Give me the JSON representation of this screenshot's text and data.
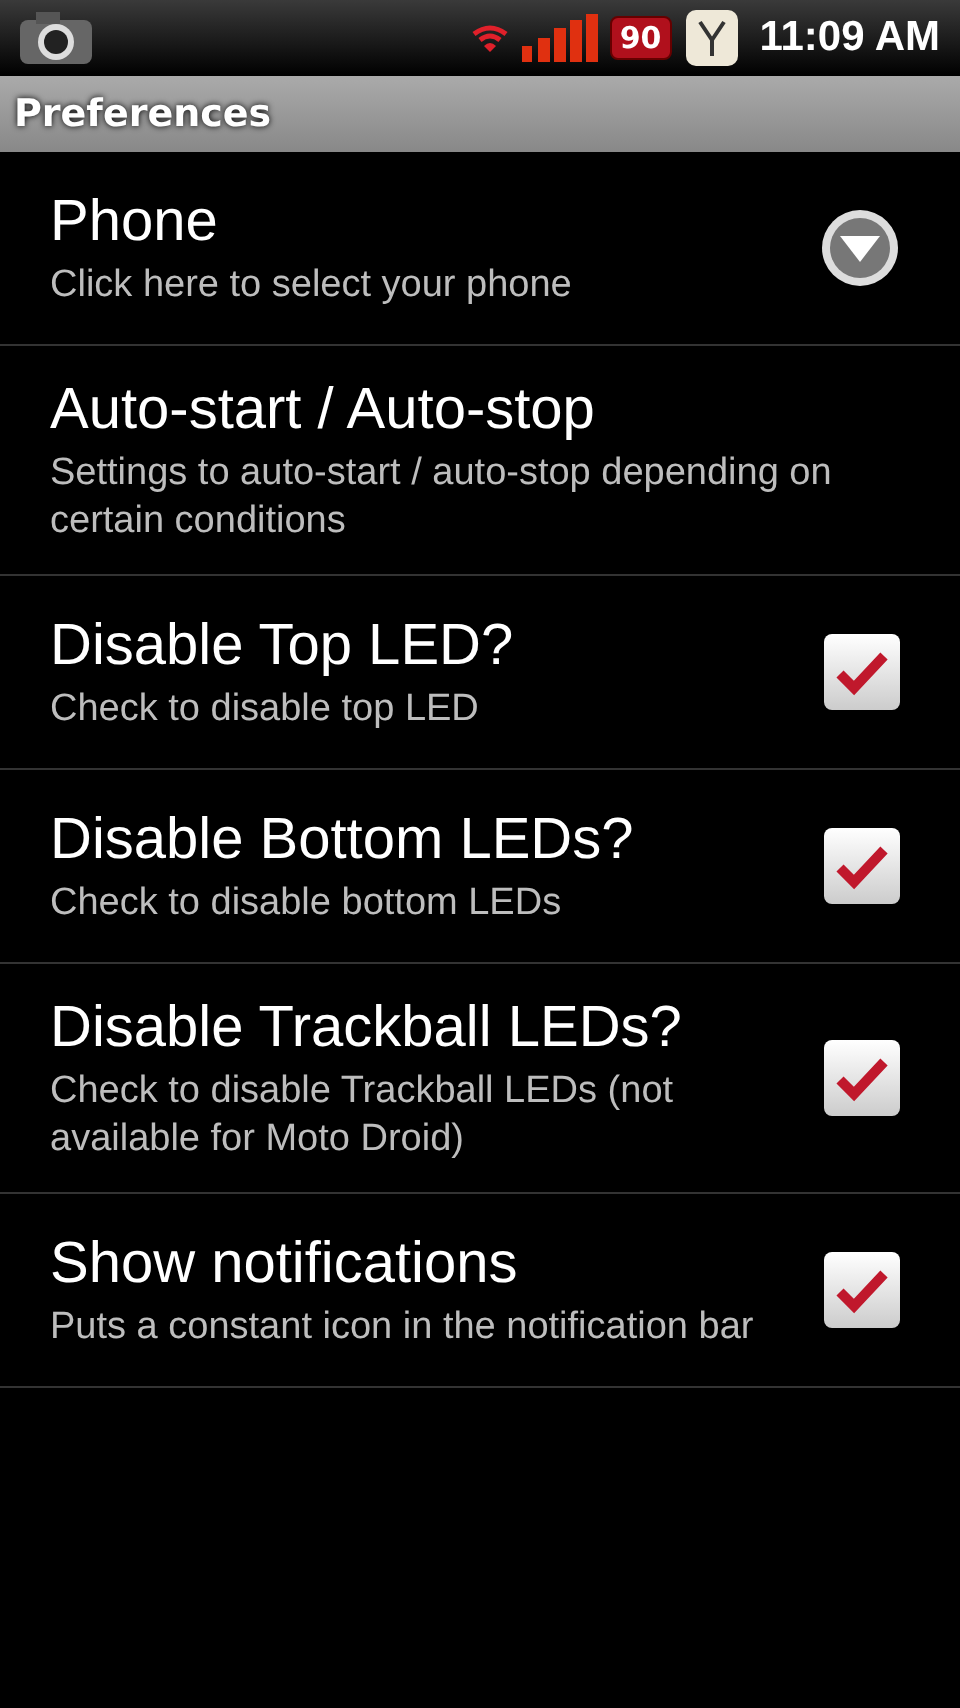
{
  "status_bar": {
    "battery_badge": "90",
    "time": "11:09 AM"
  },
  "title_bar": {
    "title": "Preferences"
  },
  "preferences": [
    {
      "kind": "dropdown",
      "title": "Phone",
      "summary": "Click here to select your phone"
    },
    {
      "kind": "screen",
      "title": "Auto-start / Auto-stop",
      "summary": "Settings to auto-start / auto-stop depending on certain conditions"
    },
    {
      "kind": "checkbox",
      "title": "Disable Top LED?",
      "summary": "Check to disable top LED",
      "checked": true
    },
    {
      "kind": "checkbox",
      "title": "Disable Bottom LEDs?",
      "summary": "Check to disable bottom LEDs",
      "checked": true
    },
    {
      "kind": "checkbox",
      "title": "Disable Trackball LEDs?",
      "summary": "Check to disable Trackball LEDs (not available for Moto Droid)",
      "checked": true
    },
    {
      "kind": "checkbox",
      "title": "Show notifications",
      "summary": "Puts a constant icon in the notification bar",
      "checked": true
    }
  ]
}
